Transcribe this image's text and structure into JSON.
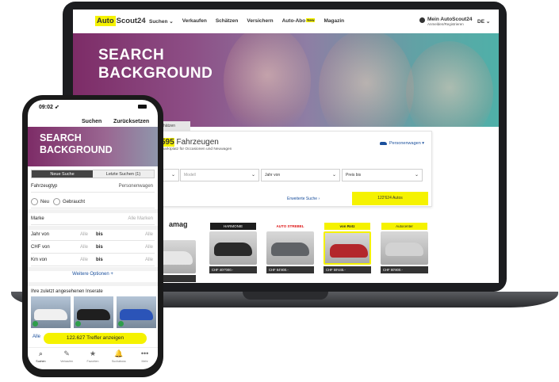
{
  "laptop": {
    "logo": {
      "part1": "Auto",
      "part2": "Scout24"
    },
    "nav": [
      {
        "label": "Suchen ⌄"
      },
      {
        "label": "Verkaufen"
      },
      {
        "label": "Schätzen"
      },
      {
        "label": "Versichern"
      },
      {
        "label": "Auto-Abo",
        "badge": "New"
      },
      {
        "label": "Magazin"
      }
    ],
    "account": {
      "title": "Mein AutoScout24",
      "sub": "Anmelden/Registrieren",
      "lang": "DE ⌄"
    },
    "hero_title_1": "SEARCH",
    "hero_title_2": "BACKGROUND",
    "tab_label": "hätzen",
    "count_highlight": "595",
    "count_text": " Fahrzeugen",
    "count_sub": "marktplatz für Occasionen und Neuwagen",
    "vehicle_type": "Personenwagen ▾",
    "selects": [
      {
        "label": "",
        "chev": "⌄"
      },
      {
        "label": "Modell",
        "chev": "⌄"
      },
      {
        "label": "Jahr von",
        "chev": "⌄"
      },
      {
        "label": "Preis bis",
        "chev": "⌄"
      }
    ],
    "advanced": "Erweiterte Suche ›",
    "cta": "122'624 Autos",
    "dealer_label": "amag",
    "dealers": [
      {
        "logo": "",
        "price": "7800.-",
        "logo_color": "#ffffff",
        "car_color": "#e6e6e6"
      },
      {
        "logo": "HARMONIE",
        "price": "CHF 407'000.-",
        "logo_color": "#1d1d1d",
        "car_color": "#2a2a2a"
      },
      {
        "logo": "AUTO STREBEL",
        "price": "CHF 84'800.-",
        "logo_color": "#ffffff",
        "car_color": "#5f6266"
      },
      {
        "logo": "von Rotz",
        "price": "CHF 59'445.-",
        "logo_color": "#f5f200",
        "car_color": "#b3262b"
      },
      {
        "logo": "Autocenter",
        "price": "CHF 80'800.-",
        "logo_color": "#f5f200",
        "car_color": "#d2d2d2"
      }
    ]
  },
  "phone": {
    "time": "09:02 ➶",
    "header": {
      "search": "Suchen",
      "reset": "Zurücksetzen"
    },
    "hero_title_1": "SEARCH",
    "hero_title_2": "BACKGROUND",
    "segments": {
      "new": "Neue Suche",
      "last": "Letzte Suchen (1)"
    },
    "vehicle_type_label": "Fahrzeugtyp",
    "vehicle_type_value": "Personenwagen",
    "condition": {
      "new": "Neu",
      "used": "Gebraucht"
    },
    "brand_label": "Marke",
    "brand_value": "Alle Marken",
    "ranges": [
      {
        "label": "Jahr von",
        "from": "Alle",
        "to_label": "bis",
        "to": "Alle"
      },
      {
        "label": "CHF von",
        "from": "Alle",
        "to_label": "bis",
        "to": "Alle"
      },
      {
        "label": "Km von",
        "from": "Alle",
        "to_label": "bis",
        "to": "Alle"
      }
    ],
    "more_options": "Weitere Optionen  +",
    "recent_title": "Ihre zuletzt angesehenen Inserate",
    "recent_car_colors": [
      "#f0f0f0",
      "#1f1f1f",
      "#2b54b8"
    ],
    "alle": "Alle",
    "cta": "122.627 Treffer anzeigen",
    "tabs": [
      {
        "icon": "⌕",
        "label": "Suchen"
      },
      {
        "icon": "✎",
        "label": "Verkaufen"
      },
      {
        "icon": "★",
        "label": "Favoriten"
      },
      {
        "icon": "🔔",
        "label": "Suchaboss"
      },
      {
        "icon": "•••",
        "label": "Mehr"
      }
    ]
  }
}
